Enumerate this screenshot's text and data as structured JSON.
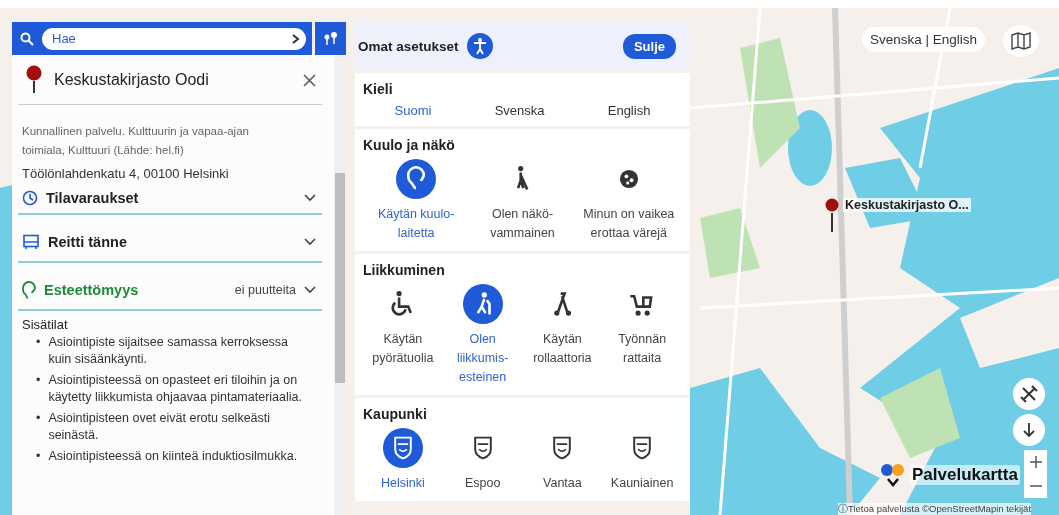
{
  "search": {
    "placeholder": "Hae"
  },
  "place": {
    "title": "Keskustakirjasto Oodi",
    "description": "Kunnallinen palvelu. Kulttuurin ja vapaa-ajan toimiala, Kulttuuri (Lähde: hel.fi)",
    "address": "Töölönlahdenkatu 4,  00100 Helsinki",
    "sections": [
      {
        "kind": "clock",
        "title": "Tilavaraukset"
      },
      {
        "kind": "route",
        "title": "Reitti tänne"
      },
      {
        "kind": "accessibility",
        "title": "Esteettömyys",
        "status": "ei puutteita"
      }
    ],
    "accessibility": {
      "heading": "Sisätilat",
      "bullet": "•",
      "items": [
        "Asiointipiste sijaitsee samassa kerroksessa kuin sisäänkäynti.",
        "Asiointipisteessä on opasteet eri tiloihin ja on käytetty liikkumista ohjaavaa pintamateriaalia.",
        "Asiointipisteen ovet eivät erotu selkeästi seinästä.",
        "Asiointipisteessä on kiinteä induktiosilmukka."
      ]
    }
  },
  "settings": {
    "title": "Omat asetukset",
    "close": "Sulje",
    "sections": [
      {
        "title": "Kieli",
        "kind": "text",
        "options": [
          {
            "label": "Suomi",
            "selected": true
          },
          {
            "label": "Svenska",
            "selected": false
          },
          {
            "label": "English",
            "selected": false
          }
        ]
      },
      {
        "title": "Kuulo ja näkö",
        "kind": "icon",
        "options": [
          {
            "label": "Käytän kuulo-laitetta",
            "selected": true
          },
          {
            "label": "Olen näkö-vammainen",
            "selected": false
          },
          {
            "label": "Minun on vaikea erottaa värejä",
            "selected": false
          }
        ]
      },
      {
        "title": "Liikkuminen",
        "kind": "icon",
        "options": [
          {
            "label": "Käytän pyörätuolia",
            "selected": false
          },
          {
            "label": "Olen liikkumis-esteinen",
            "selected": true
          },
          {
            "label": "Käytän rollaattoria",
            "selected": false
          },
          {
            "label": "Työnnän rattaita",
            "selected": false
          }
        ]
      },
      {
        "title": "Kaupunki",
        "kind": "icon",
        "options": [
          {
            "label": "Helsinki",
            "selected": true
          },
          {
            "label": "Espoo",
            "selected": false
          },
          {
            "label": "Vantaa",
            "selected": false
          },
          {
            "label": "Kauniainen",
            "selected": false
          }
        ]
      }
    ]
  },
  "map": {
    "marker_label": "Keskustakirjasto O...",
    "language_switch": "Svenska | English",
    "logo": "Palvelukartta",
    "attribution": "ⓘTietoa palvelusta ©OpenStreetMapin tekijät"
  }
}
